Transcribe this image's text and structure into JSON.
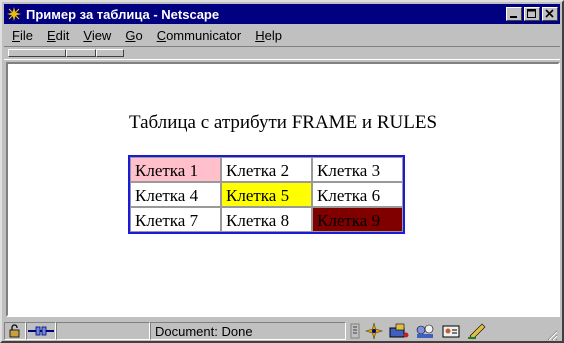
{
  "window": {
    "title": "Пример за таблица - Netscape"
  },
  "menu": [
    {
      "underline": "F",
      "rest": "ile"
    },
    {
      "underline": "E",
      "rest": "dit"
    },
    {
      "underline": "V",
      "rest": "iew"
    },
    {
      "underline": "G",
      "rest": "o"
    },
    {
      "underline": "C",
      "rest": "ommunicator"
    },
    {
      "underline": "H",
      "rest": "elp"
    }
  ],
  "page": {
    "caption": "Таблица с атрибути FRAME и RULES",
    "table": [
      [
        {
          "text": "Клетка 1",
          "bg": "#ffc0cb"
        },
        {
          "text": "Клетка 2",
          "bg": "#ffffff"
        },
        {
          "text": "Клетка 3",
          "bg": "#ffffff"
        }
      ],
      [
        {
          "text": "Клетка 4",
          "bg": "#ffffff"
        },
        {
          "text": "Клетка 5",
          "bg": "#ffff00"
        },
        {
          "text": "Клетка 6",
          "bg": "#ffffff"
        }
      ],
      [
        {
          "text": "Клетка 7",
          "bg": "#ffffff"
        },
        {
          "text": "Клетка 8",
          "bg": "#ffffff"
        },
        {
          "text": "Клетка 9",
          "bg": "#800000"
        }
      ]
    ]
  },
  "status": {
    "text": "Document: Done"
  }
}
